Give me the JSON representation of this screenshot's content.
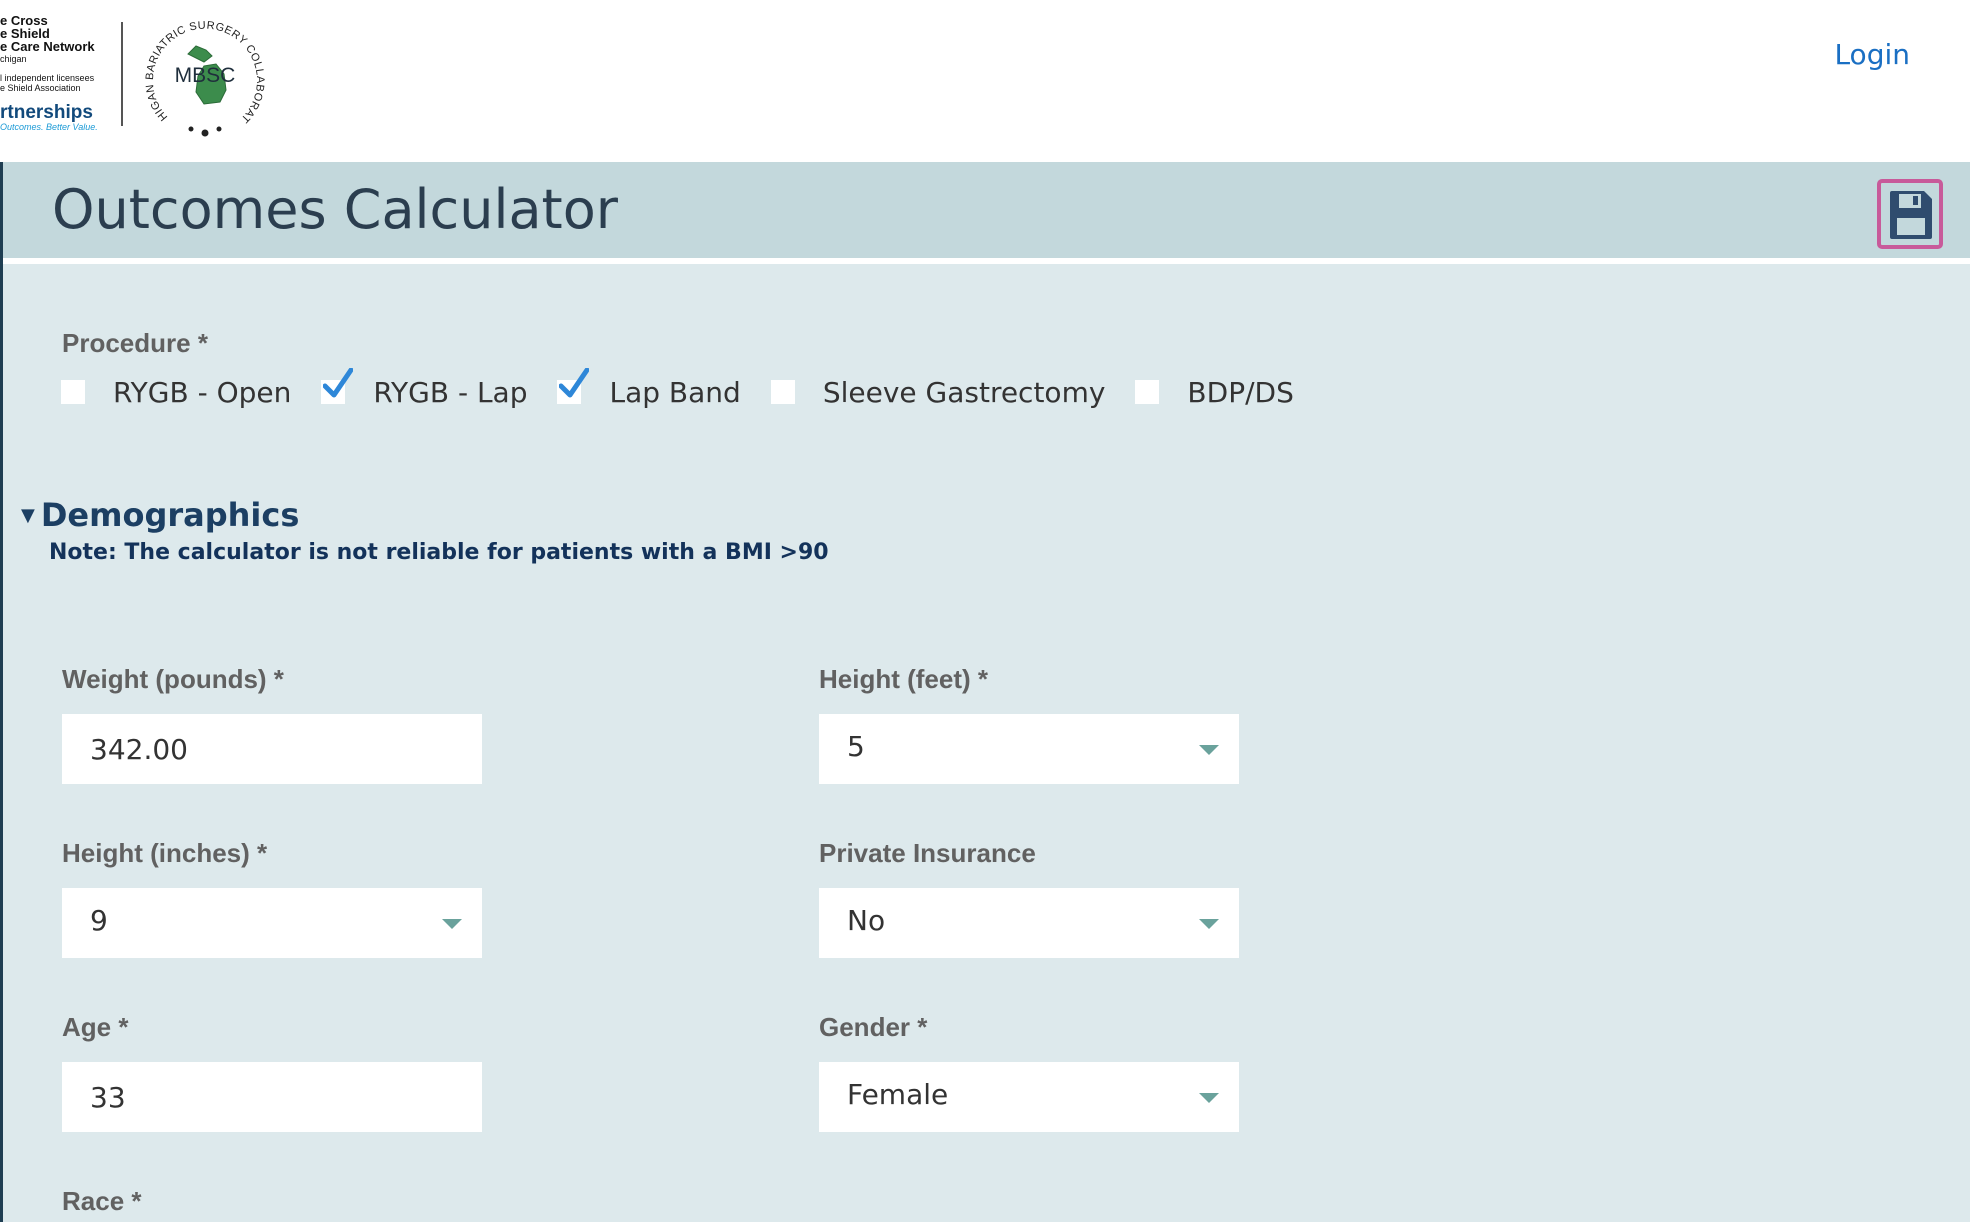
{
  "header": {
    "logo_lines": [
      "e Cross",
      "e Shield",
      "e Care Network",
      "chigan"
    ],
    "logo_licensee_lines": [
      "l independent licensees",
      "e Shield Association"
    ],
    "logo_brand": "rtnerships",
    "logo_tagline": "Outcomes. Better Value.",
    "seal_arc_text": "MICHIGAN BARIATRIC SURGERY COLLABORATIVE",
    "seal_initials": "MBSC",
    "login_label": "Login"
  },
  "page": {
    "title": "Outcomes Calculator",
    "save_icon": "floppy-disk-icon"
  },
  "procedure": {
    "label": "Procedure *",
    "options": [
      {
        "label": "RYGB - Open",
        "checked": false
      },
      {
        "label": "RYGB - Lap",
        "checked": true
      },
      {
        "label": "Lap Band",
        "checked": true
      },
      {
        "label": "Sleeve Gastrectomy",
        "checked": false
      },
      {
        "label": "BDP/DS",
        "checked": false
      }
    ]
  },
  "demographics": {
    "title": "Demographics",
    "note": "Note: The calculator is not reliable for patients with a BMI >90",
    "fields": {
      "weight": {
        "label": "Weight (pounds) *",
        "value": "342.00"
      },
      "height_feet": {
        "label": "Height (feet) *",
        "value": "5"
      },
      "height_inches": {
        "label": "Height (inches) *",
        "value": "9"
      },
      "private_insurance": {
        "label": "Private Insurance",
        "value": "No"
      },
      "age": {
        "label": "Age *",
        "value": "33"
      },
      "gender": {
        "label": "Gender *",
        "value": "Female"
      },
      "race": {
        "label": "Race *"
      }
    }
  },
  "colors": {
    "title_bar": "#c3d8dc",
    "panel": "#dde9ec",
    "link": "#1a6fc3",
    "save_border": "#c85a9a",
    "checkmark": "#2e87d8",
    "section_title": "#1c3f63"
  }
}
